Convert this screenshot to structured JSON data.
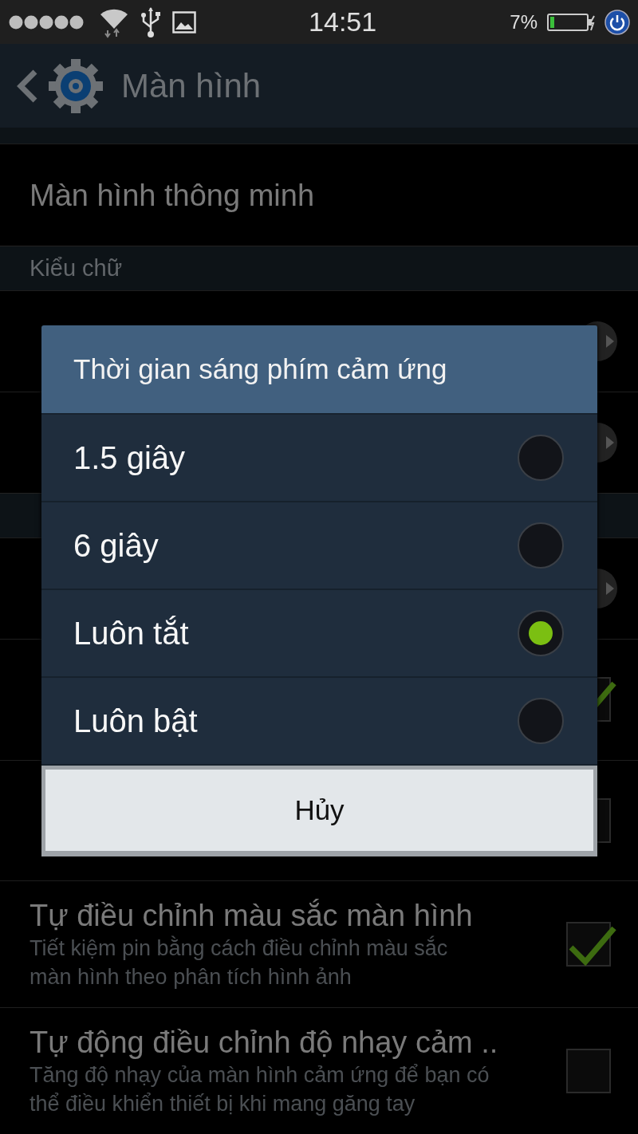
{
  "status_bar": {
    "time": "14:51",
    "battery": "7%"
  },
  "header": {
    "title": "Màn hình"
  },
  "list": [
    {
      "kind": "plain",
      "title": "Màn hình thông minh"
    },
    {
      "kind": "section",
      "title": "Kiểu chữ"
    },
    {
      "kind": "link"
    },
    {
      "kind": "link"
    },
    {
      "kind": "section"
    },
    {
      "kind": "link"
    },
    {
      "kind": "checkbox",
      "checked": true
    },
    {
      "kind": "checkbox",
      "checked": false
    },
    {
      "kind": "checkbox",
      "title": "Tự điều chỉnh màu sắc màn hình",
      "subtitle": [
        "Tiết kiệm pin bằng cách điều chỉnh màu sắc",
        "màn hình theo phân tích hình ảnh"
      ],
      "checked": true
    },
    {
      "kind": "checkbox",
      "title": "Tự động điều chỉnh độ nhạy cảm ..",
      "subtitle": [
        "Tăng độ nhạy của màn hình cảm ứng để bạn có",
        "thể điều khiển thiết bị khi mang găng tay"
      ],
      "checked": false
    }
  ],
  "dialog": {
    "title": "Thời gian sáng phím cảm ứng",
    "options": [
      {
        "label": "1.5 giây",
        "selected": false
      },
      {
        "label": "6 giây",
        "selected": false
      },
      {
        "label": "Luôn tắt",
        "selected": true
      },
      {
        "label": "Luôn bật",
        "selected": false
      }
    ],
    "cancel": "Hủy"
  }
}
